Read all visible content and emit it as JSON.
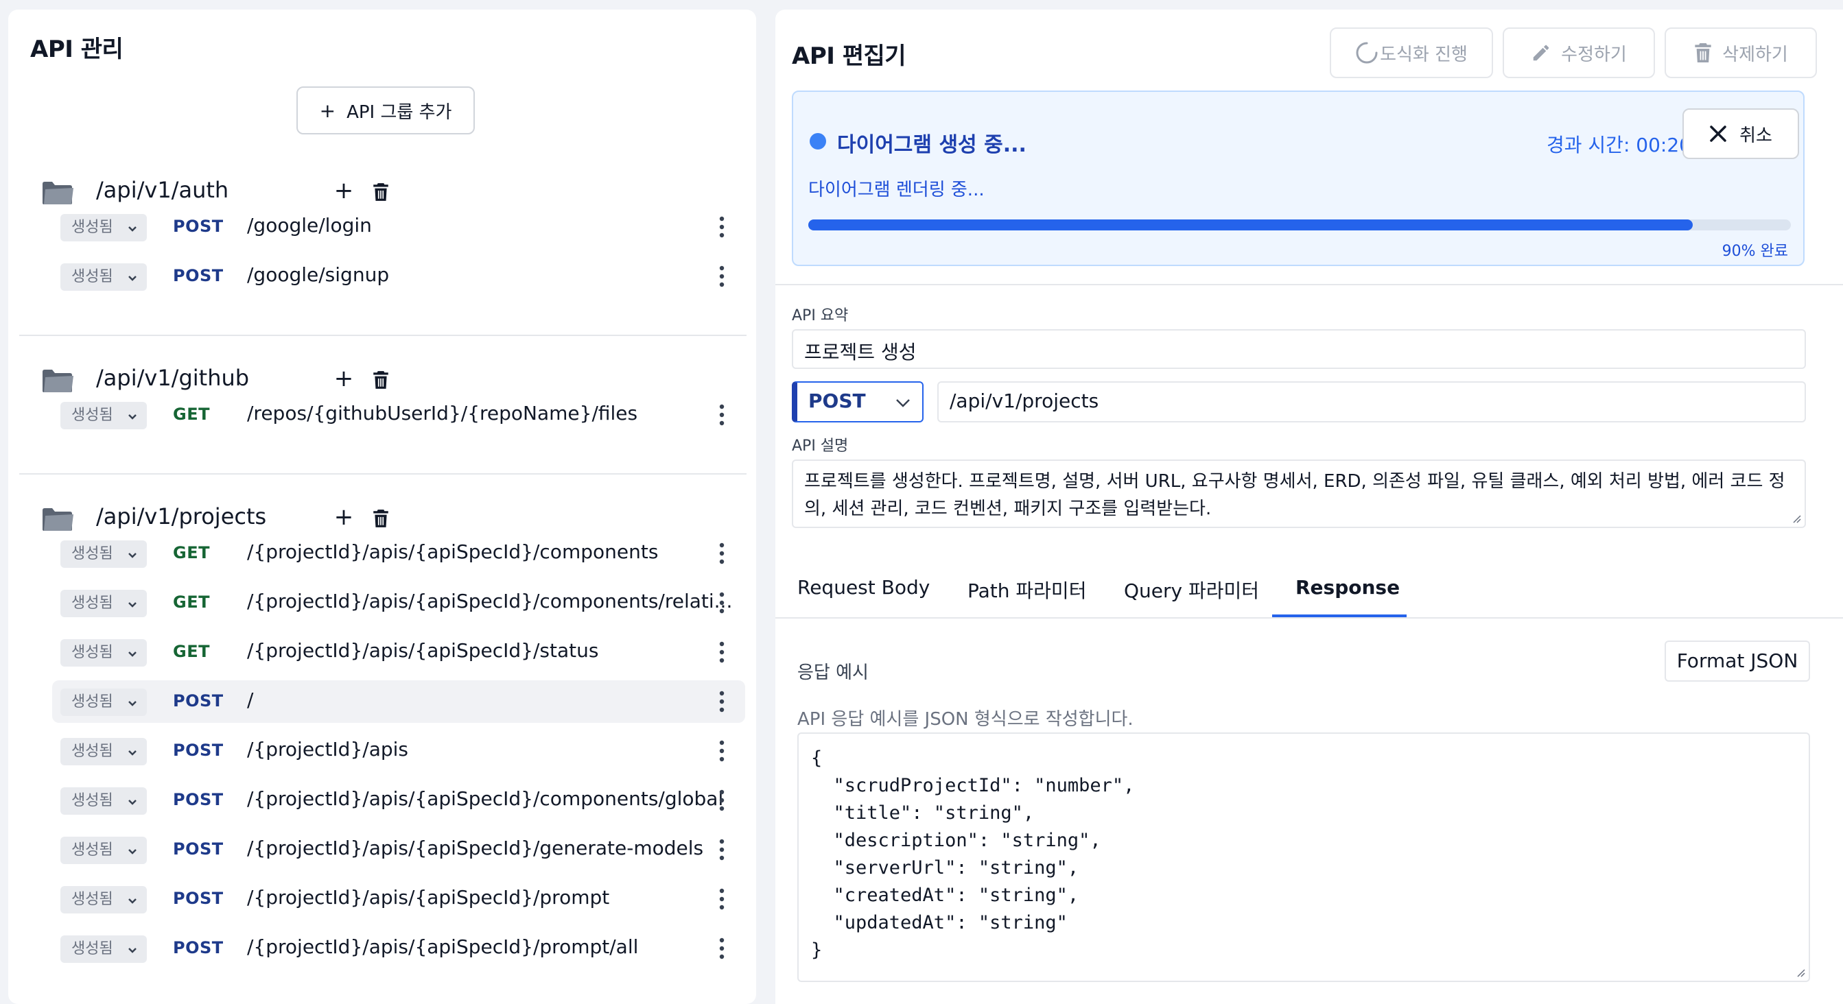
{
  "left": {
    "title": "API 관리",
    "add_group_label": "API 그룹 추가",
    "add_glyph": "+",
    "groups": [
      {
        "path": "/api/v1/auth",
        "apis": [
          {
            "status": "생성됨",
            "method": "POST",
            "path": "/google/login"
          },
          {
            "status": "생성됨",
            "method": "POST",
            "path": "/google/signup"
          }
        ]
      },
      {
        "path": "/api/v1/github",
        "apis": [
          {
            "status": "생성됨",
            "method": "GET",
            "path": "/repos/{githubUserId}/{repoName}/files"
          }
        ]
      },
      {
        "path": "/api/v1/projects",
        "apis": [
          {
            "status": "생성됨",
            "method": "GET",
            "path": "/{projectId}/apis/{apiSpecId}/components"
          },
          {
            "status": "생성됨",
            "method": "GET",
            "path": "/{projectId}/apis/{apiSpecId}/components/relati..."
          },
          {
            "status": "생성됨",
            "method": "GET",
            "path": "/{projectId}/apis/{apiSpecId}/status"
          },
          {
            "status": "생성됨",
            "method": "POST",
            "path": "/"
          },
          {
            "status": "생성됨",
            "method": "POST",
            "path": "/{projectId}/apis"
          },
          {
            "status": "생성됨",
            "method": "POST",
            "path": "/{projectId}/apis/{apiSpecId}/components/global"
          },
          {
            "status": "생성됨",
            "method": "POST",
            "path": "/{projectId}/apis/{apiSpecId}/generate-models"
          },
          {
            "status": "생성됨",
            "method": "POST",
            "path": "/{projectId}/apis/{apiSpecId}/prompt"
          },
          {
            "status": "생성됨",
            "method": "POST",
            "path": "/{projectId}/apis/{apiSpecId}/prompt/all"
          }
        ]
      }
    ]
  },
  "editor": {
    "title": "API 편집기",
    "diagram_button": "도식화 진행",
    "edit_button": "수정하기",
    "delete_button": "삭제하기",
    "progress": {
      "status": "다이어그램 생성 중...",
      "elapsed": "경과 시간: 00:20",
      "cancel": "취소",
      "detail": "다이어그램 렌더링 중...",
      "percent_label": "90% 완료",
      "value": 0.9
    },
    "summary_label": "API 요약",
    "summary_value": "프로젝트 생성",
    "method": "POST",
    "endpoint": "/api/v1/projects",
    "description_label": "API 설명",
    "description_line1": "프로젝트를 생성한다. 프로젝트명, 설명, 서버 URL, 요구사항 명세서, ERD, 의존성 파일, 유틸 클래스, 예외 처리 방법, 에러 코드 정",
    "description_line2": "의, 세션 관리, 코드 컨벤션, 패키지 구조를 입력받는다.",
    "tabs": [
      "Request Body",
      "Path 파라미터",
      "Query 파라미터",
      "Response"
    ],
    "active_tab": "Response",
    "response_label": "응답 예시",
    "format_button": "Format JSON",
    "response_hint": "API 응답 예시를 JSON 형식으로 작성합니다.",
    "response_code": [
      "{",
      "  \"scrudProjectId\": \"number\",",
      "  \"title\": \"string\",",
      "  \"description\": \"string\",",
      "  \"serverUrl\": \"string\",",
      "  \"createdAt\": \"string\",",
      "  \"updatedAt\": \"string\"",
      "}"
    ]
  },
  "colors": {
    "post": "#1e3a8a",
    "get": "#166534",
    "accent": "#2563eb",
    "progress_bg": "#eff6ff"
  }
}
